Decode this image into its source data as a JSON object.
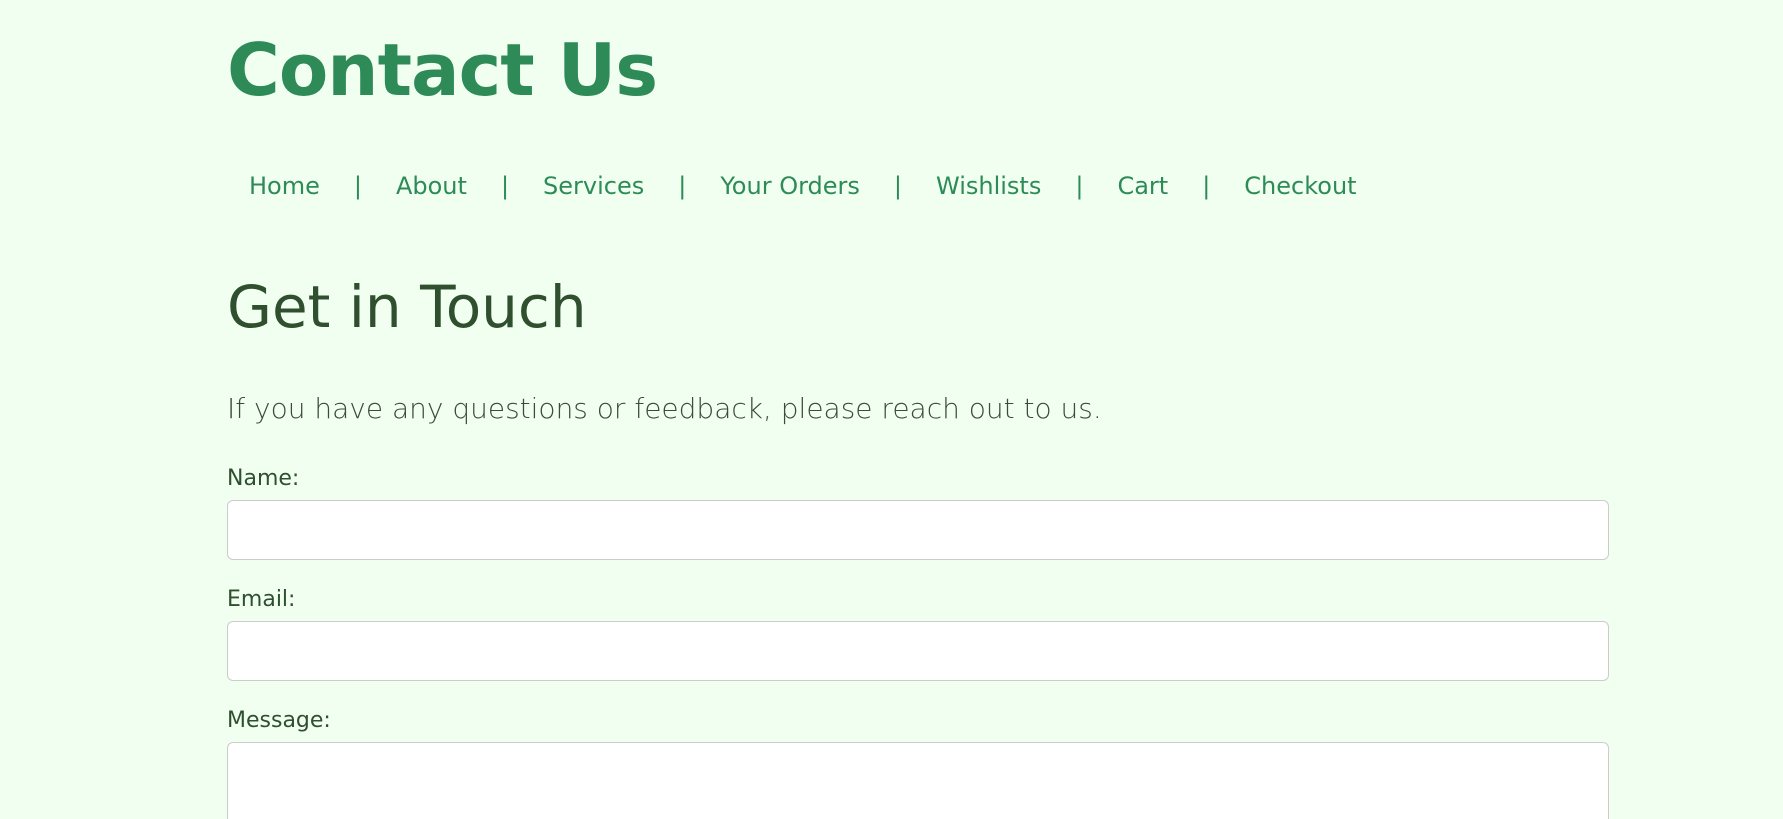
{
  "header": {
    "title": "Contact Us"
  },
  "nav": {
    "items": [
      {
        "label": "Home"
      },
      {
        "label": "About"
      },
      {
        "label": "Services"
      },
      {
        "label": "Your Orders"
      },
      {
        "label": "Wishlists"
      },
      {
        "label": "Cart"
      },
      {
        "label": "Checkout"
      }
    ],
    "separator": "|"
  },
  "main": {
    "heading": "Get in Touch",
    "intro": "If you have any questions or feedback, please reach out to us.",
    "form": {
      "name_label": "Name:",
      "name_value": "",
      "email_label": "Email:",
      "email_value": "",
      "message_label": "Message:",
      "message_value": ""
    }
  },
  "colors": {
    "background": "#f0fff0",
    "accent": "#2e8b57",
    "heading": "#2f4f2f"
  }
}
